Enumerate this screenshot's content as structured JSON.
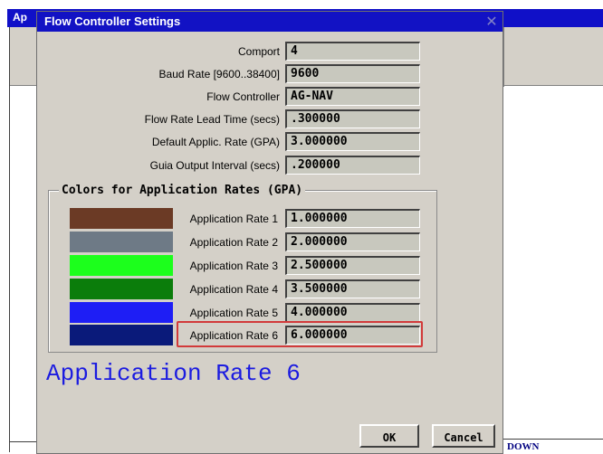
{
  "background_window": {
    "title_fragment": "Ap",
    "bottom_text": "DOWN"
  },
  "dialog": {
    "title": "Flow Controller Settings",
    "close_glyph": "✕",
    "settings": [
      {
        "label": "Comport",
        "value": "4"
      },
      {
        "label": "Baud Rate [9600..38400]",
        "value": "9600"
      },
      {
        "label": "Flow Controller",
        "value": "AG-NAV"
      },
      {
        "label": "Flow Rate Lead Time (secs)",
        "value": ".300000"
      },
      {
        "label": "Default Applic. Rate (GPA)",
        "value": "3.000000"
      },
      {
        "label": "Guia Output Interval (secs)",
        "value": ".200000"
      }
    ],
    "colors_group": {
      "title": "Colors for Application Rates (GPA)",
      "rates": [
        {
          "label": "Application Rate 1",
          "value": "1.000000",
          "color": "#6b3a25"
        },
        {
          "label": "Application Rate 2",
          "value": "2.000000",
          "color": "#6e7a86"
        },
        {
          "label": "Application Rate 3",
          "value": "2.500000",
          "color": "#1cff1c"
        },
        {
          "label": "Application Rate 4",
          "value": "3.500000",
          "color": "#0b7d0b"
        },
        {
          "label": "Application Rate 5",
          "value": "4.000000",
          "color": "#1e1ef5"
        },
        {
          "label": "Application Rate 6",
          "value": "6.000000",
          "color": "#0a1a7a"
        }
      ]
    },
    "selected_rate_display": "Application Rate 6",
    "buttons": {
      "ok": "OK",
      "cancel": "Cancel"
    }
  }
}
